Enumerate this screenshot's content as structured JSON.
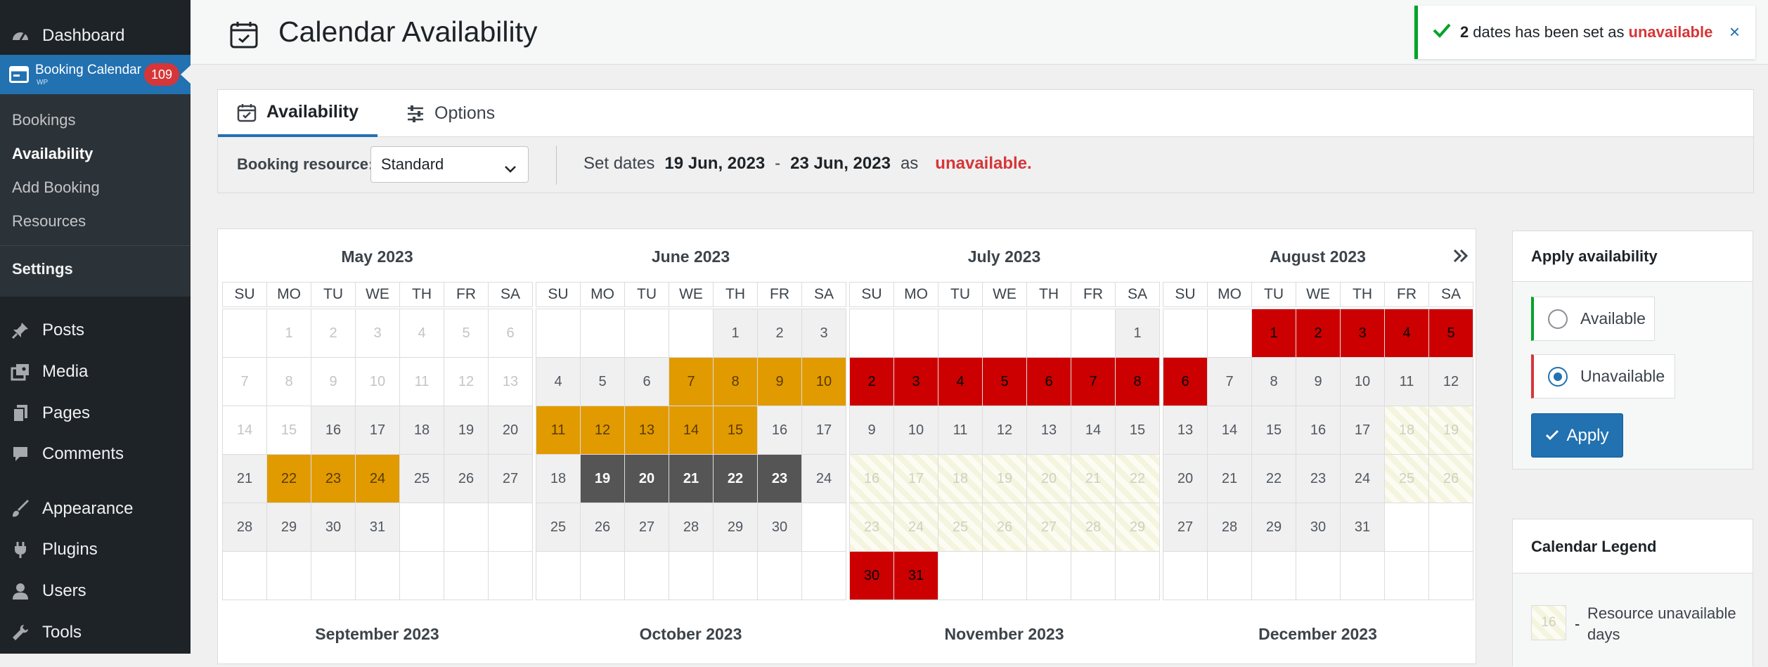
{
  "sidebar": {
    "dashboard": "Dashboard",
    "booking_calendar": {
      "title": "Booking Calendar",
      "sub": "WP",
      "badge": "109"
    },
    "submenu": [
      "Bookings",
      "Availability",
      "Add Booking",
      "Resources",
      "Settings"
    ],
    "items": [
      "Posts",
      "Media",
      "Pages",
      "Comments",
      "Appearance",
      "Plugins",
      "Users",
      "Tools"
    ]
  },
  "header": {
    "title": "Calendar Availability"
  },
  "notice": {
    "count": "2",
    "text": "dates has been set as",
    "status": "unavailable",
    "close": "×"
  },
  "tabs": [
    "Availability",
    "Options"
  ],
  "toolbar": {
    "resource_label": "Booking resource:",
    "resource_value": "Standard",
    "set_dates": "Set dates",
    "date_from": "19 Jun, 2023",
    "dash": "-",
    "date_to": "23 Jun, 2023",
    "as": "as",
    "status": "unavailable."
  },
  "calendar": {
    "weekdays": [
      "SU",
      "MO",
      "TU",
      "WE",
      "TH",
      "FR",
      "SA"
    ],
    "months": [
      {
        "title": "May 2023",
        "start": 1,
        "days": 31,
        "past": [
          1,
          2,
          3,
          4,
          5,
          6,
          7,
          8,
          9,
          10,
          11,
          12,
          13,
          14,
          15
        ],
        "unavailable": [],
        "pending": [
          22,
          23,
          24
        ],
        "selected": [],
        "hatched": []
      },
      {
        "title": "June 2023",
        "start": 4,
        "days": 30,
        "past": [],
        "unavailable": [],
        "pending": [
          7,
          8,
          9,
          10,
          11,
          12,
          13,
          14,
          15
        ],
        "selected": [
          19,
          20,
          21,
          22,
          23
        ],
        "hatched": []
      },
      {
        "title": "July 2023",
        "start": 6,
        "days": 31,
        "past": [],
        "unavailable": [
          2,
          3,
          4,
          5,
          6,
          7,
          8,
          30,
          31
        ],
        "pending": [],
        "selected": [],
        "hatched": [
          16,
          17,
          18,
          19,
          20,
          21,
          22,
          23,
          24,
          25,
          26,
          27,
          28,
          29
        ]
      },
      {
        "title": "August 2023",
        "start": 2,
        "days": 31,
        "past": [],
        "unavailable": [
          1,
          2,
          3,
          4,
          5,
          6
        ],
        "pending": [],
        "selected": [],
        "hatched": [
          18,
          19,
          25,
          26
        ]
      }
    ],
    "next_months": [
      "September 2023",
      "October 2023",
      "November 2023",
      "December 2023"
    ]
  },
  "apply": {
    "title": "Apply availability",
    "options": [
      "Available",
      "Unavailable"
    ],
    "selected": "Unavailable",
    "button": "Apply"
  },
  "legend": {
    "title": "Calendar Legend",
    "sample_day": "16",
    "dash": "-",
    "text": "Resource unavailable days"
  },
  "colors": {
    "accent": "#2271b1",
    "unavailable": "#cc0000",
    "pending": "#e19b00",
    "selected": "#555555",
    "success": "#00a32a"
  }
}
